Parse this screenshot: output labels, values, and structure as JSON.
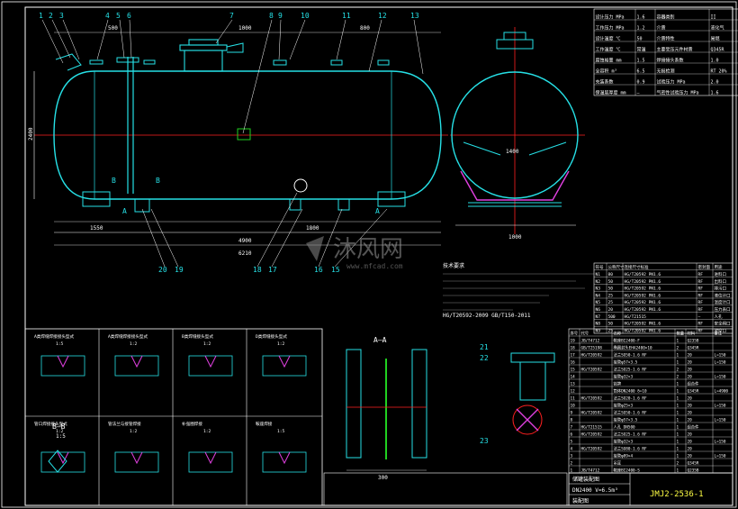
{
  "drawing": {
    "drawing_number": "JMJ2-2536-1",
    "watermark_cn": "沐风网",
    "watermark_url": "www.mfcad.com",
    "title_block": {
      "line1": "储罐装配图",
      "line2": "DN2400  V=6.5m³",
      "line3": "装配图"
    },
    "part_callouts_top": [
      "1",
      "2",
      "3",
      "4",
      "5",
      "6",
      "7",
      "8",
      "9",
      "10",
      "11",
      "12",
      "13"
    ],
    "part_callouts_bottom": [
      "20",
      "19",
      "18",
      "17",
      "16",
      "15"
    ],
    "part_callouts_detail": [
      "21",
      "22",
      "23"
    ],
    "section_labels": {
      "aa": "A—A",
      "bb": "B—B",
      "b": "B",
      "a": "A"
    },
    "dimensions": {
      "d1000_top": "1000",
      "d4900_bottom": "4900",
      "d1000_side": "1000",
      "d2400": "2400",
      "d1800": "1800",
      "d500": "500",
      "d800": "800",
      "d1600": "1600",
      "d1400": "1400",
      "d300": "300",
      "d1550": "1550",
      "d1": "1",
      "d1_5": "1:5",
      "d6210": "6210",
      "d400": "400"
    },
    "ref_standard": "HG/T20592-2009  GB/T150-2011",
    "tech_req_title": "技术要求",
    "weld_detail_titles": [
      "A类焊缝焊接接头型式",
      "A类焊缝焊接接头型式",
      "B类焊缝接头型式",
      "D类焊缝接头型式",
      "管口焊接接头型式",
      "管法兰与接管焊接",
      "补强圈焊接",
      "鞍座焊接"
    ],
    "detail_scales": [
      "1:5",
      "1:2",
      "1:2",
      "1:2",
      "1:2",
      "1:2",
      "1:2",
      "1:5"
    ],
    "nozzle_table": {
      "headers": [
        "符号",
        "公称尺寸",
        "连接尺寸标准",
        "密封面",
        "用途"
      ],
      "rows": [
        [
          "N1",
          "80",
          "HG/T20592 PN1.6",
          "RF",
          "进料口"
        ],
        [
          "N2",
          "50",
          "HG/T20592 PN1.6",
          "RF",
          "出料口"
        ],
        [
          "N3",
          "50",
          "HG/T20592 PN1.6",
          "RF",
          "排污口"
        ],
        [
          "N4",
          "25",
          "HG/T20592 PN1.6",
          "RF",
          "液位计口"
        ],
        [
          "N5",
          "25",
          "HG/T20592 PN1.6",
          "RF",
          "温度计口"
        ],
        [
          "N6",
          "20",
          "HG/T20592 PN1.6",
          "RF",
          "压力表口"
        ],
        [
          "N7",
          "500",
          "HG/T21515",
          "—",
          "人孔"
        ],
        [
          "N8",
          "50",
          "HG/T20592 PN1.6",
          "RF",
          "安全阀口"
        ],
        [
          "N9",
          "25",
          "HG/T20592 PN1.6",
          "RF",
          "放空口"
        ]
      ]
    },
    "parts_list": {
      "headers": [
        "序号",
        "代号",
        "名称",
        "数量",
        "材料",
        "备注"
      ],
      "rows": [
        [
          "19",
          "JB/T4712",
          "鞍座BI2400-F",
          "1",
          "Q235B",
          ""
        ],
        [
          "18",
          "GB/T25198",
          "椭圆封头EHA2400×10",
          "2",
          "Q345R",
          ""
        ],
        [
          "17",
          "HG/T20592",
          "法兰SO50-1.6 RF",
          "1",
          "20",
          "L=150"
        ],
        [
          "16",
          "",
          "接管φ57×3.5",
          "1",
          "20",
          "L=150"
        ],
        [
          "15",
          "HG/T20592",
          "法兰SO25-1.6 RF",
          "2",
          "20",
          ""
        ],
        [
          "14",
          "",
          "接管φ32×3",
          "2",
          "20",
          "L=150"
        ],
        [
          "13",
          "",
          "铭牌",
          "1",
          "组合件",
          ""
        ],
        [
          "12",
          "",
          "筒体DN2400 δ=10",
          "1",
          "Q345R",
          "L=4900"
        ],
        [
          "11",
          "HG/T20592",
          "法兰SO20-1.6 RF",
          "1",
          "20",
          ""
        ],
        [
          "10",
          "",
          "接管φ25×3",
          "1",
          "20",
          "L=150"
        ],
        [
          "9",
          "HG/T20592",
          "法兰SO50-1.6 RF",
          "1",
          "20",
          ""
        ],
        [
          "8",
          "",
          "接管φ57×3.5",
          "1",
          "20",
          "L=150"
        ],
        [
          "7",
          "HG/T21515",
          "人孔 DN500",
          "1",
          "组合件",
          ""
        ],
        [
          "6",
          "HG/T20592",
          "法兰SO25-1.6 RF",
          "1",
          "20",
          ""
        ],
        [
          "5",
          "",
          "接管φ32×3",
          "1",
          "20",
          "L=150"
        ],
        [
          "4",
          "HG/T20592",
          "法兰SO80-1.6 RF",
          "1",
          "20",
          ""
        ],
        [
          "3",
          "",
          "接管φ89×4",
          "1",
          "20",
          "L=150"
        ],
        [
          "2",
          "",
          "吊耳",
          "2",
          "Q345R",
          ""
        ],
        [
          "1",
          "JB/T4712",
          "鞍座BI2400-S",
          "1",
          "Q235B",
          ""
        ]
      ]
    },
    "spec_table": {
      "rows": [
        [
          "设计压力 MPa",
          "1.6",
          "容器类别",
          "II"
        ],
        [
          "工作压力 MPa",
          "1.2",
          "介质",
          "液化气"
        ],
        [
          "设计温度 ℃",
          "50",
          "介质特性",
          "易燃"
        ],
        [
          "工作温度 ℃",
          "常温",
          "主要受压元件材质",
          "Q345R"
        ],
        [
          "腐蚀裕量 mm",
          "1.5",
          "焊接接头系数",
          "1.0"
        ],
        [
          "全容积 m³",
          "6.5",
          "无损检测",
          "RT 20%"
        ],
        [
          "充装系数",
          "0.9",
          "试验压力 MPa",
          "2.0"
        ],
        [
          "保温层厚度 mm",
          "—",
          "气密性试验压力 MPa",
          "1.6"
        ]
      ]
    },
    "colors": {
      "background": "#000000",
      "vessel_line": "#26e0e6",
      "centerline": "#ff2020",
      "table_line": "#ffffff",
      "magenta": "#e040e0",
      "green": "#20d020",
      "yellow": "#ffff44",
      "label": "#ffffff"
    }
  }
}
